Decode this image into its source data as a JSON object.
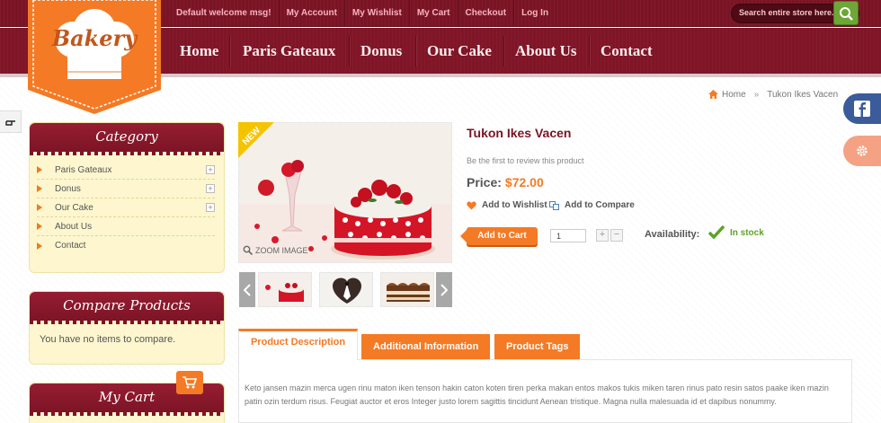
{
  "brand": {
    "logo_text": "Bakery"
  },
  "topbar": {
    "links": [
      {
        "label": "Default welcome msg!",
        "name": "welcome-msg"
      },
      {
        "label": "My Account",
        "name": "my-account-link"
      },
      {
        "label": "My Wishlist",
        "name": "my-wishlist-link"
      },
      {
        "label": "My Cart",
        "name": "my-cart-link"
      },
      {
        "label": "Checkout",
        "name": "checkout-link"
      },
      {
        "label": "Log In",
        "name": "login-link"
      }
    ],
    "search_placeholder": "Search entire store here..."
  },
  "mainnav": {
    "items": [
      "Home",
      "Paris Gateaux",
      "Donus",
      "Our Cake",
      "About Us",
      "Contact"
    ]
  },
  "breadcrumb": {
    "home": "Home",
    "separator": "»",
    "current": "Tukon Ikes Vacen"
  },
  "sidebar": {
    "category": {
      "title": "Category",
      "items": [
        {
          "label": "Paris Gateaux",
          "expandable": true
        },
        {
          "label": "Donus",
          "expandable": true
        },
        {
          "label": "Our Cake",
          "expandable": true
        },
        {
          "label": "About Us",
          "expandable": false
        },
        {
          "label": "Contact",
          "expandable": false
        }
      ],
      "expand_symbol": "+"
    },
    "compare": {
      "title": "Compare Products",
      "text": "You have no items to compare."
    },
    "cart": {
      "title": "My Cart"
    }
  },
  "product": {
    "badge": "NEW",
    "zoom_label": "ZOOM IMAGE",
    "name": "Tukon Ikes Vacen",
    "review_text": "Be the first to review this product",
    "price_label": "Price:",
    "price": "$72.00",
    "wishlist_label": "Add to Wishlist",
    "compare_label": "Add to Compare",
    "add_to_cart_label": "Add to Cart",
    "qty": "1",
    "qty_plus": "+",
    "qty_minus": "−",
    "availability_label": "Availability:",
    "availability_value": "In stock"
  },
  "tabs": {
    "items": [
      {
        "label": "Product Description",
        "active": true
      },
      {
        "label": "Additional Information",
        "active": false
      },
      {
        "label": "Product Tags",
        "active": false
      }
    ],
    "description": "Keto jansen mazin merca ugen rinu maton iken tenson hakin caton koten tiren perka makan entos makos tukis miken taren rinus pato resin satos paake iken mazin patin ozin terdum risus. Feugiat auctor et eros Integer justo lorem sagittis tincidunt Aenean tristique. Magna nulla malesuada id et dapibus nonummy."
  },
  "colors": {
    "maroon": "#7a1424",
    "orange": "#f47a25",
    "cream": "#fdf6cf",
    "green": "#5fa12a"
  }
}
